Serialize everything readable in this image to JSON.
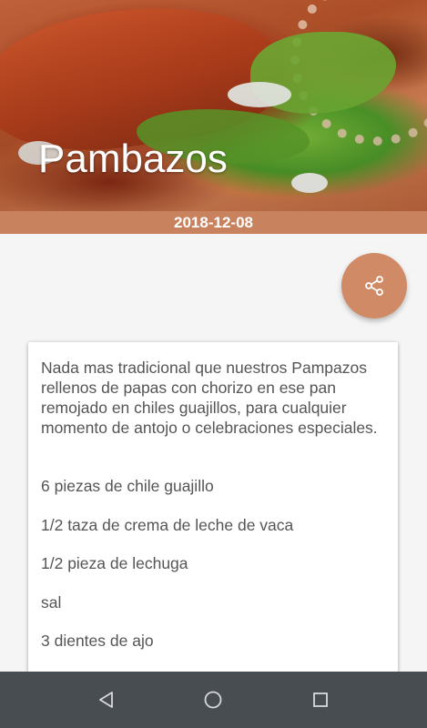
{
  "recipe": {
    "title": "Pambazos",
    "date": "2018-12-08",
    "description": "Nada mas tradicional que nuestros Pampazos rellenos de papas con chorizo en ese pan remojado en chiles guajillos, para cualquier momento de antojo o celebraciones especiales.",
    "ingredients": [
      "6 piezas de chile guajillo",
      "1/2 taza de crema de leche de vaca",
      "1/2 pieza de lechuga",
      "sal",
      "3 dientes de ajo"
    ]
  },
  "actions": {
    "share_icon": "share-icon"
  },
  "navbar": {
    "back_icon": "back-icon",
    "home_icon": "home-icon",
    "recents_icon": "recents-icon"
  },
  "colors": {
    "date_bar": "#c9825e",
    "fab": "#d18a66",
    "navbar": "#484d52",
    "background": "#f5f5f5"
  }
}
